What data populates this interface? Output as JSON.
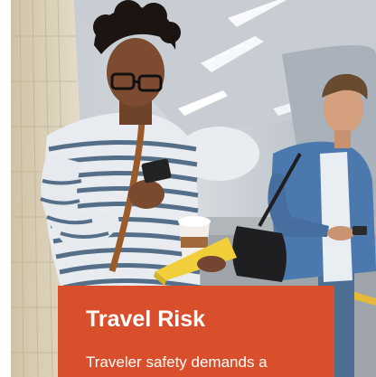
{
  "hero": {
    "image": "travelers-at-train-station-photo",
    "accent_color": "#d94f2b"
  },
  "card": {
    "title": "Travel Risk",
    "text": "Traveler safety demands a dynamic response. Global"
  }
}
